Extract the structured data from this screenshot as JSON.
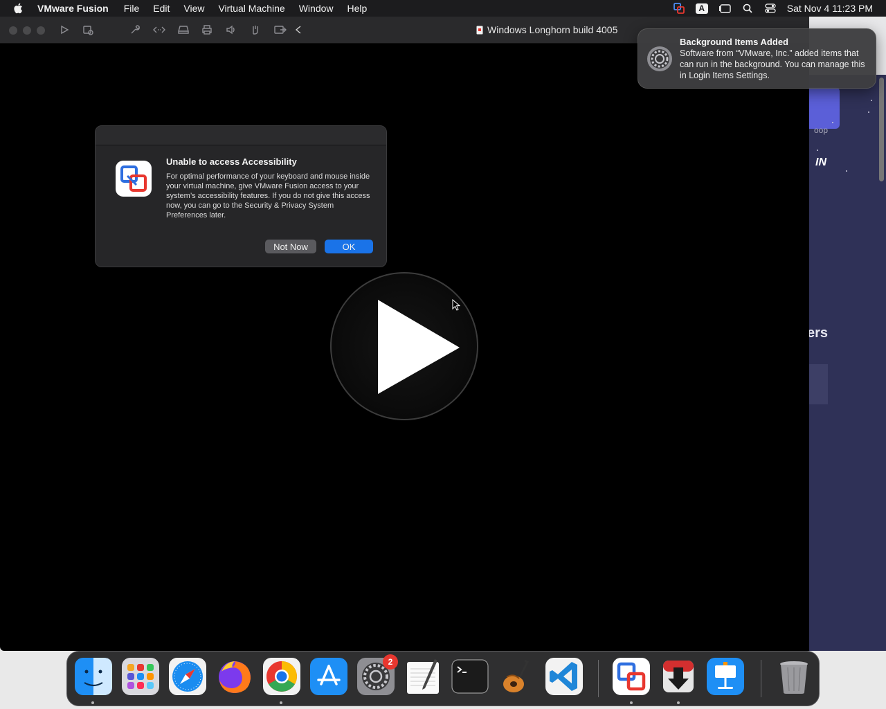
{
  "menubar": {
    "app_name": "VMware Fusion",
    "menus": [
      "File",
      "Edit",
      "View",
      "Virtual Machine",
      "Window",
      "Help"
    ],
    "input_source": "A",
    "clock": "Sat Nov 4  11:23 PM"
  },
  "window": {
    "title": "Windows Longhorn build 4005"
  },
  "dialog": {
    "title": "Unable to access Accessibility",
    "message": "For optimal performance of your keyboard and mouse inside your virtual machine, give VMware Fusion access to your system’s accessibility features. If you do not give this access now, you can go to the Security & Privacy System Preferences later.",
    "not_now_label": "Not Now",
    "ok_label": "OK"
  },
  "notification": {
    "title": "Background Items Added",
    "body": "Software from “VMware, Inc.” added items that can run in the background. You can manage this in Login Items Settings."
  },
  "background_window": {
    "button_fragment": "IN",
    "text_fragment": "oop",
    "heading_fragment": "ers"
  },
  "dock": {
    "settings_badge": "2"
  },
  "colors": {
    "accent": "#1a73e8",
    "badge": "#e8372f"
  }
}
